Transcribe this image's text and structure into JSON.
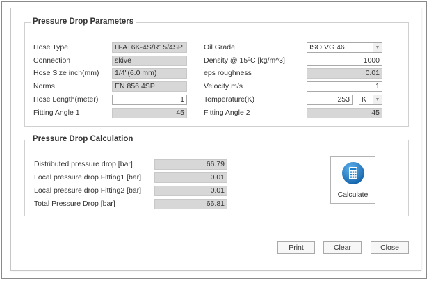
{
  "params": {
    "title": "Pressure Drop Parameters",
    "hose_type": {
      "label": "Hose Type",
      "value": "H-AT6K-4S/R15/4SP"
    },
    "connection": {
      "label": "Connection",
      "value": "skive"
    },
    "hose_size": {
      "label": "Hose Size inch(mm)",
      "value": "1/4\"(6.0 mm)"
    },
    "norms": {
      "label": "Norms",
      "value": "EN 856 4SP"
    },
    "hose_length": {
      "label": "Hose Length(meter)",
      "value": "1"
    },
    "fitting_angle_1": {
      "label": "Fitting Angle 1",
      "value": "45"
    },
    "oil_grade": {
      "label": "Oil Grade",
      "value": "ISO VG 46"
    },
    "density": {
      "label": "Density @ 15ºC [kg/m^3]",
      "value": "1000"
    },
    "eps_roughness": {
      "label": "eps roughness",
      "value": "0.01"
    },
    "velocity": {
      "label": "Velocity m/s",
      "value": "1"
    },
    "temperature": {
      "label": "Temperature(K)",
      "value": "253",
      "unit": "K"
    },
    "fitting_angle_2": {
      "label": "Fitting Angle 2",
      "value": "45"
    }
  },
  "calc": {
    "title": "Pressure Drop Calculation",
    "distributed": {
      "label": "Distributed pressure drop [bar]",
      "value": "66.79"
    },
    "local1": {
      "label": "Local pressure drop Fitting1 [bar]",
      "value": "0.01"
    },
    "local2": {
      "label": "Local pressure drop Fitting2 [bar]",
      "value": "0.01"
    },
    "total": {
      "label": "Total Pressure Drop [bar]",
      "value": "66.81"
    },
    "calculate_label": "Calculate"
  },
  "buttons": {
    "print": "Print",
    "clear": "Clear",
    "close": "Close"
  },
  "colors": {
    "readonly_bg": "#d7d7d7",
    "calc_icon_blue": "#1f7fc9"
  }
}
